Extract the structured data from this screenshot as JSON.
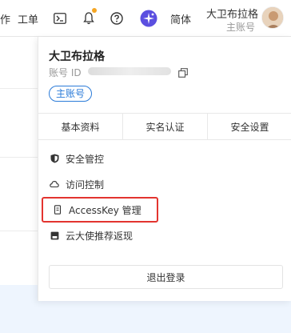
{
  "topbar": {
    "cut_char": "作",
    "ticket": "工单",
    "lang": "简体",
    "user_name": "大卫布拉格",
    "user_role": "主账号"
  },
  "panel": {
    "name": "大卫布拉格",
    "id_label": "账号 ID",
    "badge": "主账号",
    "tabs": [
      "基本资料",
      "实名认证",
      "安全设置"
    ],
    "menu": [
      {
        "label": "安全管控",
        "icon": "shield-icon"
      },
      {
        "label": "访问控制",
        "icon": "cloud-icon"
      },
      {
        "label": "AccessKey 管理",
        "icon": "key-icon"
      },
      {
        "label": "云大使推荐返现",
        "icon": "gift-icon"
      }
    ],
    "logout": "退出登录"
  },
  "colors": {
    "accent": "#2b7bd8",
    "highlight_border": "#e3342f",
    "bell_dot": "#f5a623"
  }
}
